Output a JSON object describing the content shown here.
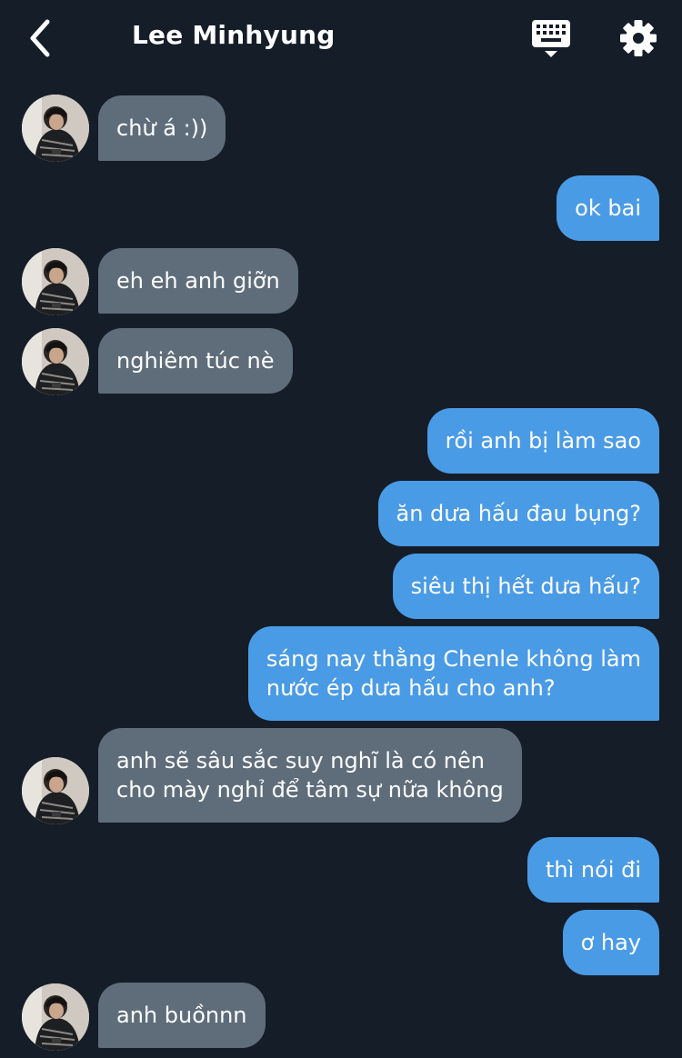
{
  "header": {
    "title": "Lee Minhyung"
  },
  "icons": {
    "back": "chevron-left-icon",
    "keyboard": "keyboard-icon",
    "settings": "gear-icon"
  },
  "colors": {
    "background": "#151d28",
    "incoming_bubble": "#5f6d7b",
    "outgoing_bubble": "#4a9be6",
    "text": "#ffffff"
  },
  "messages": [
    {
      "from": "contact",
      "text": "chừ á :))"
    },
    {
      "from": "me",
      "text": "ok bai"
    },
    {
      "from": "contact",
      "text": "eh eh anh giỡn"
    },
    {
      "from": "contact",
      "text": "nghiêm túc nè"
    },
    {
      "from": "me",
      "text": "rồi anh bị làm sao"
    },
    {
      "from": "me",
      "text": "ăn dưa hấu đau bụng?"
    },
    {
      "from": "me",
      "text": "siêu thị hết dưa hấu?"
    },
    {
      "from": "me",
      "lines": [
        "sáng nay thằng Chenle không làm",
        "nước ép dưa hấu cho anh?"
      ]
    },
    {
      "from": "contact",
      "lines": [
        "anh sẽ sâu sắc suy nghĩ là có nên",
        "cho mày nghỉ để tâm sự nữa không"
      ]
    },
    {
      "from": "me",
      "text": "thì nói đi"
    },
    {
      "from": "me",
      "text": "ơ hay"
    },
    {
      "from": "contact",
      "text": "anh buồnnn"
    }
  ]
}
